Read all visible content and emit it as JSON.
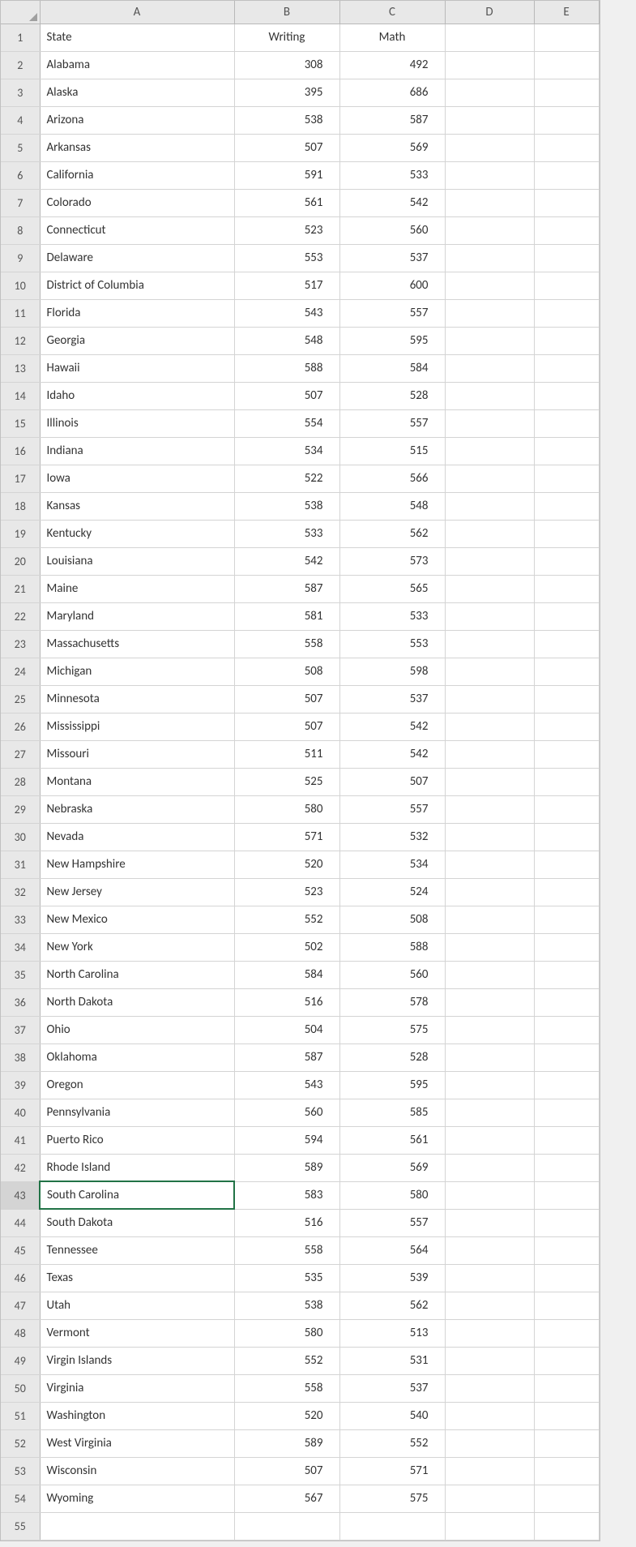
{
  "columns": [
    "A",
    "B",
    "C",
    "D",
    "E"
  ],
  "selectedCell": {
    "row": 43,
    "col": "A"
  },
  "headerRow": {
    "A": "State",
    "B": "Writing",
    "C": "Math"
  },
  "rows": [
    {
      "n": 2,
      "state": "Alabama",
      "writing": 308,
      "math": 492
    },
    {
      "n": 3,
      "state": "Alaska",
      "writing": 395,
      "math": 686
    },
    {
      "n": 4,
      "state": "Arizona",
      "writing": 538,
      "math": 587
    },
    {
      "n": 5,
      "state": "Arkansas",
      "writing": 507,
      "math": 569
    },
    {
      "n": 6,
      "state": "California",
      "writing": 591,
      "math": 533
    },
    {
      "n": 7,
      "state": "Colorado",
      "writing": 561,
      "math": 542
    },
    {
      "n": 8,
      "state": "Connecticut",
      "writing": 523,
      "math": 560
    },
    {
      "n": 9,
      "state": "Delaware",
      "writing": 553,
      "math": 537
    },
    {
      "n": 10,
      "state": "District of Columbia",
      "writing": 517,
      "math": 600
    },
    {
      "n": 11,
      "state": "Florida",
      "writing": 543,
      "math": 557
    },
    {
      "n": 12,
      "state": "Georgia",
      "writing": 548,
      "math": 595
    },
    {
      "n": 13,
      "state": "Hawaii",
      "writing": 588,
      "math": 584
    },
    {
      "n": 14,
      "state": "Idaho",
      "writing": 507,
      "math": 528
    },
    {
      "n": 15,
      "state": "Illinois",
      "writing": 554,
      "math": 557
    },
    {
      "n": 16,
      "state": "Indiana",
      "writing": 534,
      "math": 515
    },
    {
      "n": 17,
      "state": "Iowa",
      "writing": 522,
      "math": 566
    },
    {
      "n": 18,
      "state": "Kansas",
      "writing": 538,
      "math": 548
    },
    {
      "n": 19,
      "state": "Kentucky",
      "writing": 533,
      "math": 562
    },
    {
      "n": 20,
      "state": "Louisiana",
      "writing": 542,
      "math": 573
    },
    {
      "n": 21,
      "state": "Maine",
      "writing": 587,
      "math": 565
    },
    {
      "n": 22,
      "state": "Maryland",
      "writing": 581,
      "math": 533
    },
    {
      "n": 23,
      "state": "Massachusetts",
      "writing": 558,
      "math": 553
    },
    {
      "n": 24,
      "state": "Michigan",
      "writing": 508,
      "math": 598
    },
    {
      "n": 25,
      "state": "Minnesota",
      "writing": 507,
      "math": 537
    },
    {
      "n": 26,
      "state": "Mississippi",
      "writing": 507,
      "math": 542
    },
    {
      "n": 27,
      "state": "Missouri",
      "writing": 511,
      "math": 542
    },
    {
      "n": 28,
      "state": "Montana",
      "writing": 525,
      "math": 507
    },
    {
      "n": 29,
      "state": "Nebraska",
      "writing": 580,
      "math": 557
    },
    {
      "n": 30,
      "state": "Nevada",
      "writing": 571,
      "math": 532
    },
    {
      "n": 31,
      "state": "New Hampshire",
      "writing": 520,
      "math": 534
    },
    {
      "n": 32,
      "state": "New Jersey",
      "writing": 523,
      "math": 524
    },
    {
      "n": 33,
      "state": "New Mexico",
      "writing": 552,
      "math": 508
    },
    {
      "n": 34,
      "state": "New York",
      "writing": 502,
      "math": 588
    },
    {
      "n": 35,
      "state": "North Carolina",
      "writing": 584,
      "math": 560
    },
    {
      "n": 36,
      "state": "North Dakota",
      "writing": 516,
      "math": 578
    },
    {
      "n": 37,
      "state": "Ohio",
      "writing": 504,
      "math": 575
    },
    {
      "n": 38,
      "state": "Oklahoma",
      "writing": 587,
      "math": 528
    },
    {
      "n": 39,
      "state": "Oregon",
      "writing": 543,
      "math": 595
    },
    {
      "n": 40,
      "state": "Pennsylvania",
      "writing": 560,
      "math": 585
    },
    {
      "n": 41,
      "state": "Puerto Rico",
      "writing": 594,
      "math": 561
    },
    {
      "n": 42,
      "state": "Rhode Island",
      "writing": 589,
      "math": 569
    },
    {
      "n": 43,
      "state": "South Carolina",
      "writing": 583,
      "math": 580
    },
    {
      "n": 44,
      "state": "South Dakota",
      "writing": 516,
      "math": 557
    },
    {
      "n": 45,
      "state": "Tennessee",
      "writing": 558,
      "math": 564
    },
    {
      "n": 46,
      "state": "Texas",
      "writing": 535,
      "math": 539
    },
    {
      "n": 47,
      "state": "Utah",
      "writing": 538,
      "math": 562
    },
    {
      "n": 48,
      "state": "Vermont",
      "writing": 580,
      "math": 513
    },
    {
      "n": 49,
      "state": "Virgin Islands",
      "writing": 552,
      "math": 531
    },
    {
      "n": 50,
      "state": "Virginia",
      "writing": 558,
      "math": 537
    },
    {
      "n": 51,
      "state": "Washington",
      "writing": 520,
      "math": 540
    },
    {
      "n": 52,
      "state": "West Virginia",
      "writing": 589,
      "math": 552
    },
    {
      "n": 53,
      "state": "Wisconsin",
      "writing": 507,
      "math": 571
    },
    {
      "n": 54,
      "state": "Wyoming",
      "writing": 567,
      "math": 575
    }
  ],
  "emptyRows": [
    55
  ]
}
